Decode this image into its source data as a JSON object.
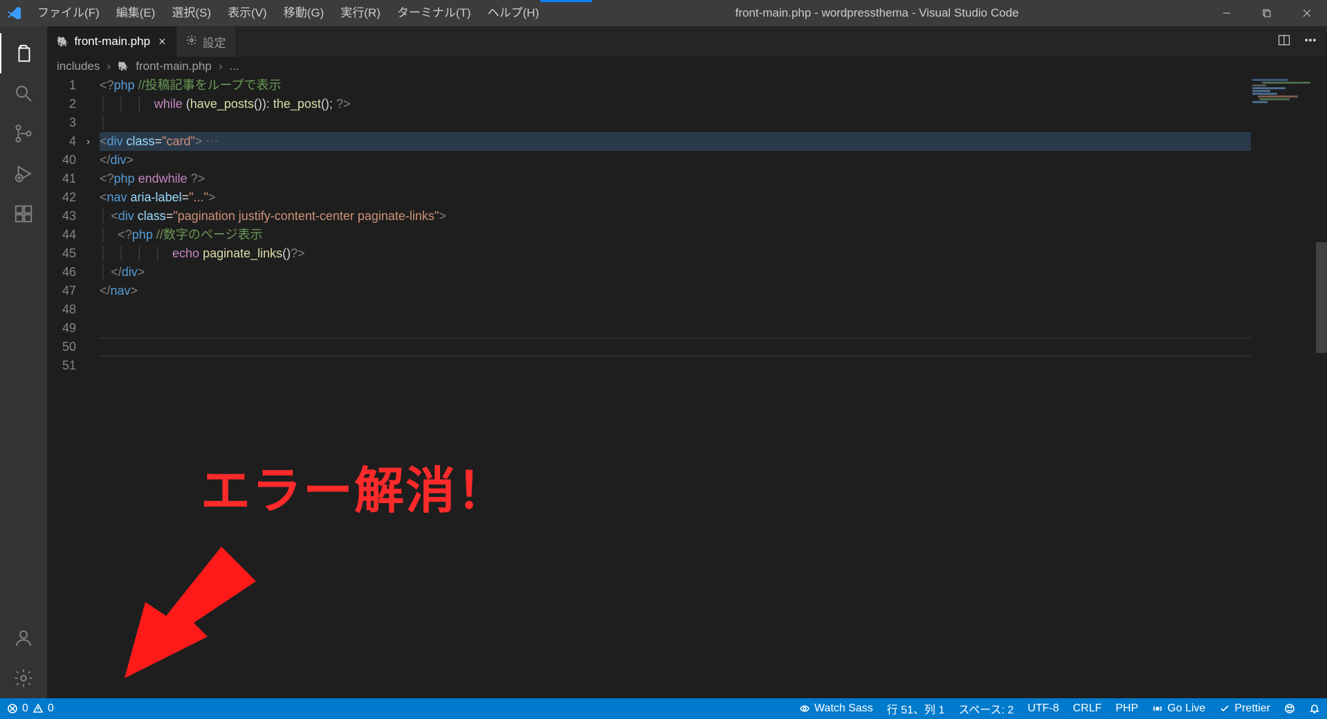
{
  "window": {
    "title": "front-main.php - wordpressthema - Visual Studio Code"
  },
  "menu": {
    "file": "ファイル(F)",
    "edit": "編集(E)",
    "select": "選択(S)",
    "view": "表示(V)",
    "go": "移動(G)",
    "run": "実行(R)",
    "terminal": "ターミナル(T)",
    "help": "ヘルプ(H)"
  },
  "tabs": {
    "active": {
      "icon": "🐘",
      "label": "front-main.php"
    },
    "other": {
      "icon_name": "gear-icon",
      "label": "設定"
    }
  },
  "breadcrumb": {
    "seg1": "includes",
    "seg2_icon": "🐘",
    "seg2": "front-main.php",
    "seg3": "..."
  },
  "gutter": [
    "1",
    "2",
    "3",
    "4",
    "40",
    "41",
    "42",
    "43",
    "44",
    "45",
    "46",
    "47",
    "48",
    "49",
    "50",
    "51"
  ],
  "code": {
    "l1": {
      "guides": "",
      "t": [
        [
          "c-tagdel",
          "<?"
        ],
        [
          "c-kw",
          "php "
        ],
        [
          "c-com",
          "//投稿記事をループで表示"
        ]
      ]
    },
    "l2": {
      "guides": "│   │   │   ",
      "t": [
        [
          "c-lbl",
          "while "
        ],
        [
          "c-txt",
          "("
        ],
        [
          "c-func",
          "have_posts"
        ],
        [
          "c-txt",
          "()):"
        ],
        [
          "c-txt",
          " "
        ],
        [
          "c-func",
          "the_post"
        ],
        [
          "c-txt",
          "(); "
        ],
        [
          "c-tagdel",
          "?>"
        ]
      ]
    },
    "l3": {
      "guides": "│",
      "t": []
    },
    "l4": {
      "guides": "",
      "hl": true,
      "t": [
        [
          "c-tagdel",
          "<"
        ],
        [
          "c-tag",
          "div "
        ],
        [
          "c-attr",
          "class"
        ],
        [
          "c-txt",
          "="
        ],
        [
          "c-str",
          "\"card\""
        ],
        [
          "c-tagdel",
          ">"
        ],
        [
          "ellip",
          " ⋯"
        ]
      ]
    },
    "l5": {
      "guides": "",
      "t": [
        [
          "c-tagdel",
          "</"
        ],
        [
          "c-tag",
          "div"
        ],
        [
          "c-tagdel",
          ">"
        ]
      ]
    },
    "l6": {
      "guides": "",
      "t": [
        [
          "c-tagdel",
          "<?"
        ],
        [
          "c-kw",
          "php "
        ],
        [
          "c-lbl",
          "endwhile "
        ],
        [
          "c-tagdel",
          "?>"
        ]
      ]
    },
    "l7": {
      "guides": "",
      "t": [
        [
          "c-tagdel",
          "<"
        ],
        [
          "c-tag",
          "nav "
        ],
        [
          "c-attr",
          "aria-label"
        ],
        [
          "c-txt",
          "="
        ],
        [
          "c-str",
          "\"...\""
        ],
        [
          "c-tagdel",
          ">"
        ]
      ]
    },
    "l8": {
      "guides": "│ ",
      "t": [
        [
          "c-tagdel",
          "<"
        ],
        [
          "c-tag",
          "div "
        ],
        [
          "c-attr",
          "class"
        ],
        [
          "c-txt",
          "="
        ],
        [
          "c-str",
          "\"pagination justify-content-center paginate-links\""
        ],
        [
          "c-tagdel",
          ">"
        ]
      ]
    },
    "l9": {
      "guides": "│   ",
      "t": [
        [
          "c-tagdel",
          "<?"
        ],
        [
          "c-kw",
          "php "
        ],
        [
          "c-com",
          "//数字のページ表示"
        ]
      ]
    },
    "l10": {
      "guides": "│   │   │   │   ",
      "t": [
        [
          "c-lbl",
          "echo "
        ],
        [
          "c-func",
          "paginate_links"
        ],
        [
          "c-txt",
          "()"
        ],
        [
          "c-tagdel",
          "?>"
        ]
      ]
    },
    "l11": {
      "guides": "│ ",
      "t": [
        [
          "c-tagdel",
          "</"
        ],
        [
          "c-tag",
          "div"
        ],
        [
          "c-tagdel",
          ">"
        ]
      ]
    },
    "l12": {
      "guides": "",
      "t": [
        [
          "c-tagdel",
          "</"
        ],
        [
          "c-tag",
          "nav"
        ],
        [
          "c-tagdel",
          ">"
        ]
      ]
    },
    "l13": {
      "guides": "",
      "t": []
    },
    "l14": {
      "guides": "",
      "t": []
    },
    "l15": {
      "guides": "",
      "t": []
    },
    "l16": {
      "guides": "",
      "t": []
    }
  },
  "status": {
    "errors": "0",
    "warnings": "0",
    "watch": "Watch Sass",
    "pos": "行 51、列 1",
    "spaces": "スペース: 2",
    "enc": "UTF-8",
    "eol": "CRLF",
    "lang": "PHP",
    "golive": "Go Live",
    "prettier": "Prettier"
  },
  "annotation": {
    "text": "エラー解消！"
  }
}
